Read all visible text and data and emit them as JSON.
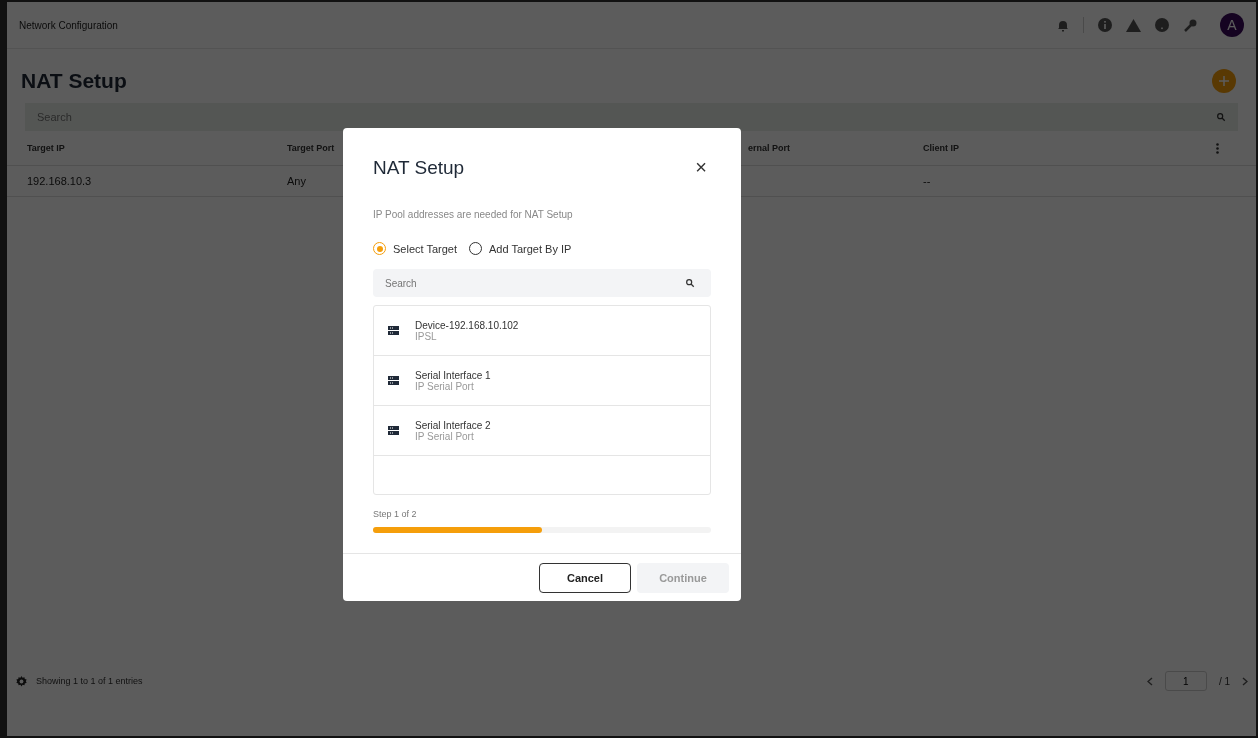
{
  "header": {
    "breadcrumb": "Network Configuration",
    "avatar": "A"
  },
  "page": {
    "title": "NAT Setup"
  },
  "table": {
    "search": {
      "placeholder": "Search"
    },
    "columns": [
      "Target IP",
      "Target Port",
      "ernal Port",
      "Client IP"
    ],
    "rows": [
      {
        "cells": [
          "192.168.10.3",
          "Any",
          "",
          "--"
        ]
      }
    ]
  },
  "footer": {
    "summary": "Showing 1 to 1 of 1 entries",
    "page": "1",
    "total": "/ 1"
  },
  "dialog": {
    "title": "NAT Setup",
    "close": "×",
    "note": "IP Pool addresses are needed for NAT Setup",
    "options": [
      {
        "label": "Select Target",
        "selected": true
      },
      {
        "label": "Add Target By IP",
        "selected": false
      }
    ],
    "search": {
      "placeholder": "Search"
    },
    "targets": [
      {
        "name": "Device-192.168.10.102",
        "type": "IPSL"
      },
      {
        "name": "Serial Interface 1",
        "type": "IP Serial Port"
      },
      {
        "name": "Serial Interface 2",
        "type": "IP Serial Port"
      }
    ],
    "step": "Step 1 of 2",
    "progress": {
      "level": 0.5
    },
    "buttons": [
      {
        "label": "Cancel",
        "disabled": false
      },
      {
        "label": "Continue",
        "disabled": true
      }
    ]
  }
}
